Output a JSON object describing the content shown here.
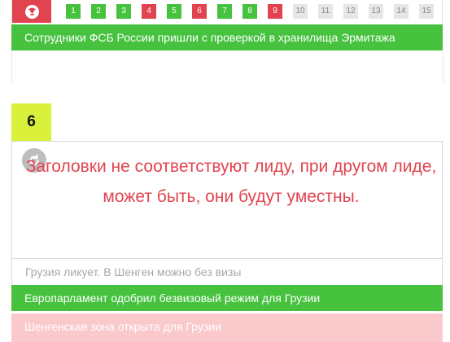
{
  "progress": {
    "steps": [
      {
        "label": "1",
        "status": "correct"
      },
      {
        "label": "2",
        "status": "correct"
      },
      {
        "label": "3",
        "status": "correct"
      },
      {
        "label": "4",
        "status": "wrong"
      },
      {
        "label": "5",
        "status": "correct"
      },
      {
        "label": "6",
        "status": "wrong"
      },
      {
        "label": "7",
        "status": "correct"
      },
      {
        "label": "8",
        "status": "correct"
      },
      {
        "label": "9",
        "status": "wrong"
      },
      {
        "label": "10",
        "status": "pending"
      },
      {
        "label": "11",
        "status": "pending"
      },
      {
        "label": "12",
        "status": "pending"
      },
      {
        "label": "13",
        "status": "pending"
      },
      {
        "label": "14",
        "status": "pending"
      },
      {
        "label": "15",
        "status": "pending"
      }
    ]
  },
  "previous_answer": "Сотрудники ФСБ России пришли с проверкой в хранилища Эрмитажа",
  "question": {
    "number": "6",
    "message": "Заголовки не соответствуют лиду, при другом лиде, может быть, они будут уместны.",
    "options": [
      "Грузия ликует. В Шенген можно без визы",
      "Европарламент одобрил безвизовый режим для Грузии",
      "Шенгенская зона открыта для Грузии"
    ]
  },
  "colors": {
    "correct": "#46c23f",
    "wrong": "#e2444f",
    "pending": "#e6e6e6",
    "badge": "#d9f13a",
    "wrong_light": "#f9c9cc"
  },
  "icons": {
    "trophy": "trophy-icon",
    "refresh": "refresh-icon"
  }
}
